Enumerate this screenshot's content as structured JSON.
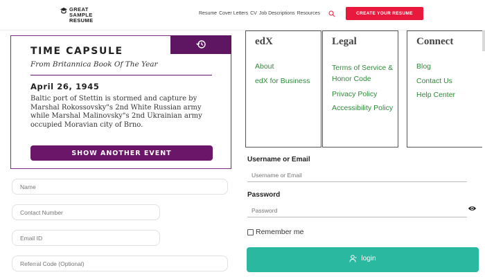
{
  "header": {
    "logo_line1": "GREAT",
    "logo_line2a": "SAMPLE",
    "logo_line2b": "RESUME",
    "nav": [
      "Resume",
      "Cover Letters",
      "CV",
      "Job Descriptions",
      "Resources"
    ],
    "cta_label": "CREATE YOUR RESUME",
    "brand_color": "#e8193c"
  },
  "time_capsule": {
    "title": "TIME CAPSULE",
    "subtitle": "From Britannica Book Of The Year",
    "date": "April 26, 1945",
    "body": "Baltic port of Stettin is stormed and capture by Marshal Rokossovsky\"s 2nd White Russian army while Marshal Malinovsky\"s 2nd Ukrainian army occupied Moravian city of Brno.",
    "button_label": "SHOW ANOTHER EVENT",
    "accent": "#5e1562",
    "tab_icon": "history-icon"
  },
  "referral_form": {
    "name_placeholder": "Name",
    "contact_placeholder": "Contact Number",
    "email_placeholder": "Email ID",
    "referral_placeholder": "Referral Code (Optional)"
  },
  "footer_columns": [
    {
      "heading": "edX",
      "links": [
        "About",
        "edX for Business"
      ]
    },
    {
      "heading": "Legal",
      "links": [
        "Terms of Service & Honor Code",
        "Privacy Policy",
        "Accessibility Policy"
      ]
    },
    {
      "heading": "Connect",
      "links": [
        "Blog",
        "Contact Us",
        "Help Center"
      ]
    }
  ],
  "login": {
    "username_label": "Username or Email",
    "username_placeholder": "Username or Email",
    "password_label": "Password",
    "password_placeholder": "Password",
    "remember_label": "Remember me",
    "button_label": "login",
    "button_color": "#2bb8a0",
    "link_color": "#2f8a3a"
  }
}
